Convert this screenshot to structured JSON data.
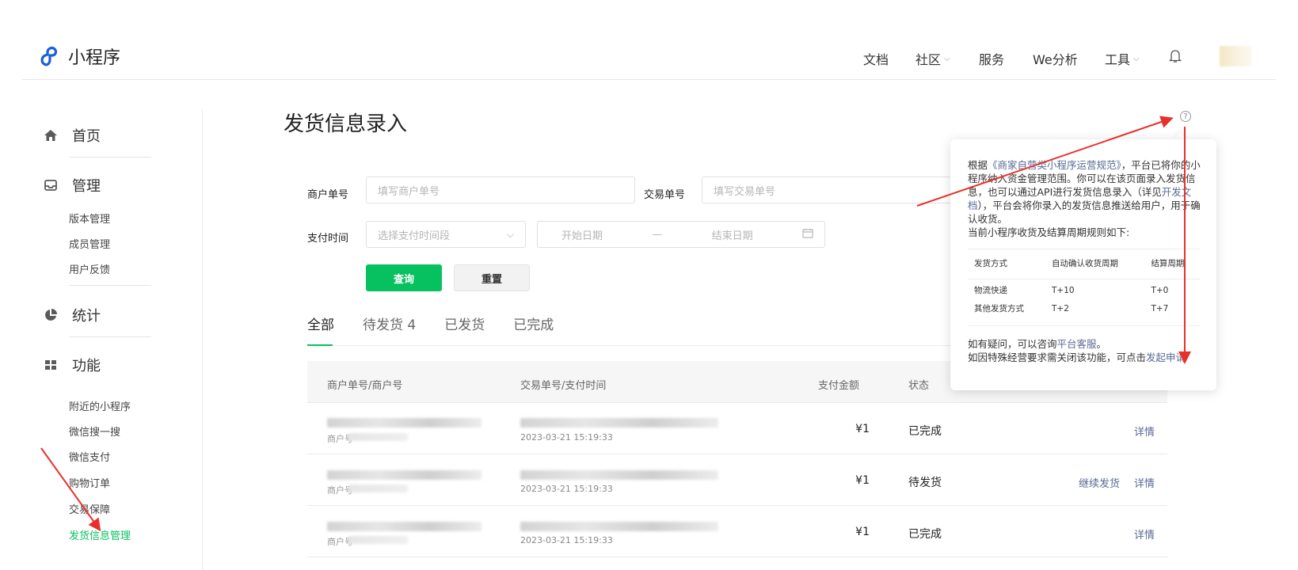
{
  "header": {
    "app_title": "小程序",
    "nav": [
      {
        "label": "文档",
        "has_dropdown": false
      },
      {
        "label": "社区",
        "has_dropdown": true
      },
      {
        "label": "服务",
        "has_dropdown": false
      },
      {
        "label": "We分析",
        "has_dropdown": false
      },
      {
        "label": "工具",
        "has_dropdown": true
      }
    ],
    "bell_icon": "bell-icon"
  },
  "sidebar": {
    "sections": [
      {
        "label": "首页",
        "icon": "home-icon"
      },
      {
        "label": "管理",
        "icon": "inbox-icon",
        "items": [
          "版本管理",
          "成员管理",
          "用户反馈"
        ]
      },
      {
        "label": "统计",
        "icon": "pie-icon"
      },
      {
        "label": "功能",
        "icon": "grid-icon",
        "items": [
          "附近的小程序",
          "微信搜一搜",
          "微信支付",
          "购物订单",
          "交易保障",
          "发货信息管理"
        ]
      }
    ],
    "active_item": "发货信息管理",
    "active_color": "#07c160"
  },
  "page": {
    "title": "发货信息录入",
    "filters": {
      "merchant_no_label": "商户单号",
      "merchant_no_placeholder": "填写商户单号",
      "trade_no_label": "交易单号",
      "trade_no_placeholder": "填写交易单号",
      "pay_time_label": "支付时间",
      "pay_time_select": "选择支付时间段",
      "start_date": "开始日期",
      "range_sep": "—",
      "end_date": "结束日期"
    },
    "buttons": {
      "query": "查询",
      "reset": "重置"
    },
    "tabs": [
      {
        "label": "全部",
        "active": true
      },
      {
        "label": "待发货 4",
        "active": false
      },
      {
        "label": "已发货",
        "active": false
      },
      {
        "label": "已完成",
        "active": false
      }
    ],
    "table": {
      "columns": [
        "商户单号/商户号",
        "交易单号/支付时间",
        "支付金额",
        "状态"
      ],
      "rows": [
        {
          "sub_label": "商户号",
          "pay_time": "2023-03-21 15:19:33",
          "amount": "¥1",
          "status": "已完成",
          "actions": [
            "详情"
          ]
        },
        {
          "sub_label": "商户号",
          "pay_time": "2023-03-21 15:19:33",
          "amount": "¥1",
          "status": "待发货",
          "actions": [
            "继续发货",
            "详情"
          ]
        },
        {
          "sub_label": "商户号",
          "pay_time": "2023-03-21 15:19:33",
          "amount": "¥1",
          "status": "已完成",
          "actions": [
            "详情"
          ]
        }
      ]
    }
  },
  "popover": {
    "p1_a": "根据",
    "p1_link": "《商家自营类小程序运营规范》",
    "p1_b": "，平台已将你的小程序纳入资金管理范围。你可以在该页面录入发货信息，也可以通过API进行发货信息录入（详见",
    "p1_link2": "开发文档",
    "p1_c": "），平台会将你录入的发货信息推送给用户，用于确认收货。",
    "p2": "当前小程序收货及结算周期规则如下:",
    "rules_header": [
      "发货方式",
      "自动确认收货周期",
      "结算周期"
    ],
    "rules_rows": [
      [
        "物流快递",
        "T+10",
        "T+0"
      ],
      [
        "其他发货方式",
        "T+2",
        "T+7"
      ]
    ],
    "q1_a": "如有疑问，可以咨询",
    "q1_link": "平台客服",
    "q1_b": "。",
    "q2_a": "如因特殊经营要求需关闭该功能，可点击",
    "q2_link": "发起申请"
  },
  "colors": {
    "primary": "#07c160",
    "link": "#576b95",
    "arrow": "#e8302a"
  }
}
